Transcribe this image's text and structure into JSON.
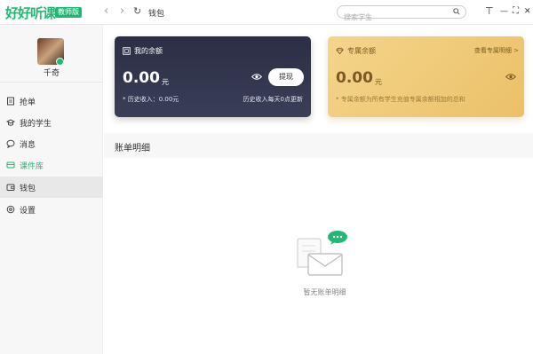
{
  "app": {
    "logo": "好好听课",
    "logo_badge": "教师版",
    "window_title": "钱包"
  },
  "nav": {
    "back": "‹",
    "forward": "›",
    "refresh": "↻"
  },
  "search": {
    "placeholder": "搜索学生"
  },
  "window_controls": {
    "pin": "⊤",
    "minimize": "—",
    "maximize": "⛶",
    "close": "✕"
  },
  "sidebar": {
    "username": "千奇",
    "items": [
      {
        "label": "抢单",
        "icon": "order-icon"
      },
      {
        "label": "我的学生",
        "icon": "students-icon"
      },
      {
        "label": "消息",
        "icon": "message-icon"
      },
      {
        "label": "课件库",
        "icon": "courseware-icon"
      },
      {
        "label": "钱包",
        "icon": "wallet-icon"
      },
      {
        "label": "设置",
        "icon": "settings-icon"
      }
    ]
  },
  "balance_card": {
    "title": "我的余额",
    "amount": "0.00",
    "unit": "元",
    "withdraw": "提现",
    "history": "* 历史收入：0.00元",
    "note": "历史收入每天0点更新"
  },
  "exclusive_card": {
    "title": "专属余额",
    "link": "查看专属明细 >",
    "amount": "0.00",
    "unit": "元",
    "note": "* 专属余额为所有学生充值专属余额相加的总和"
  },
  "bill": {
    "title": "账单明细",
    "empty_text": "暂无账单明细"
  },
  "colors": {
    "accent": "#22b873",
    "dark_card": "#2b2e44",
    "gold_card": "#f4d58b"
  }
}
